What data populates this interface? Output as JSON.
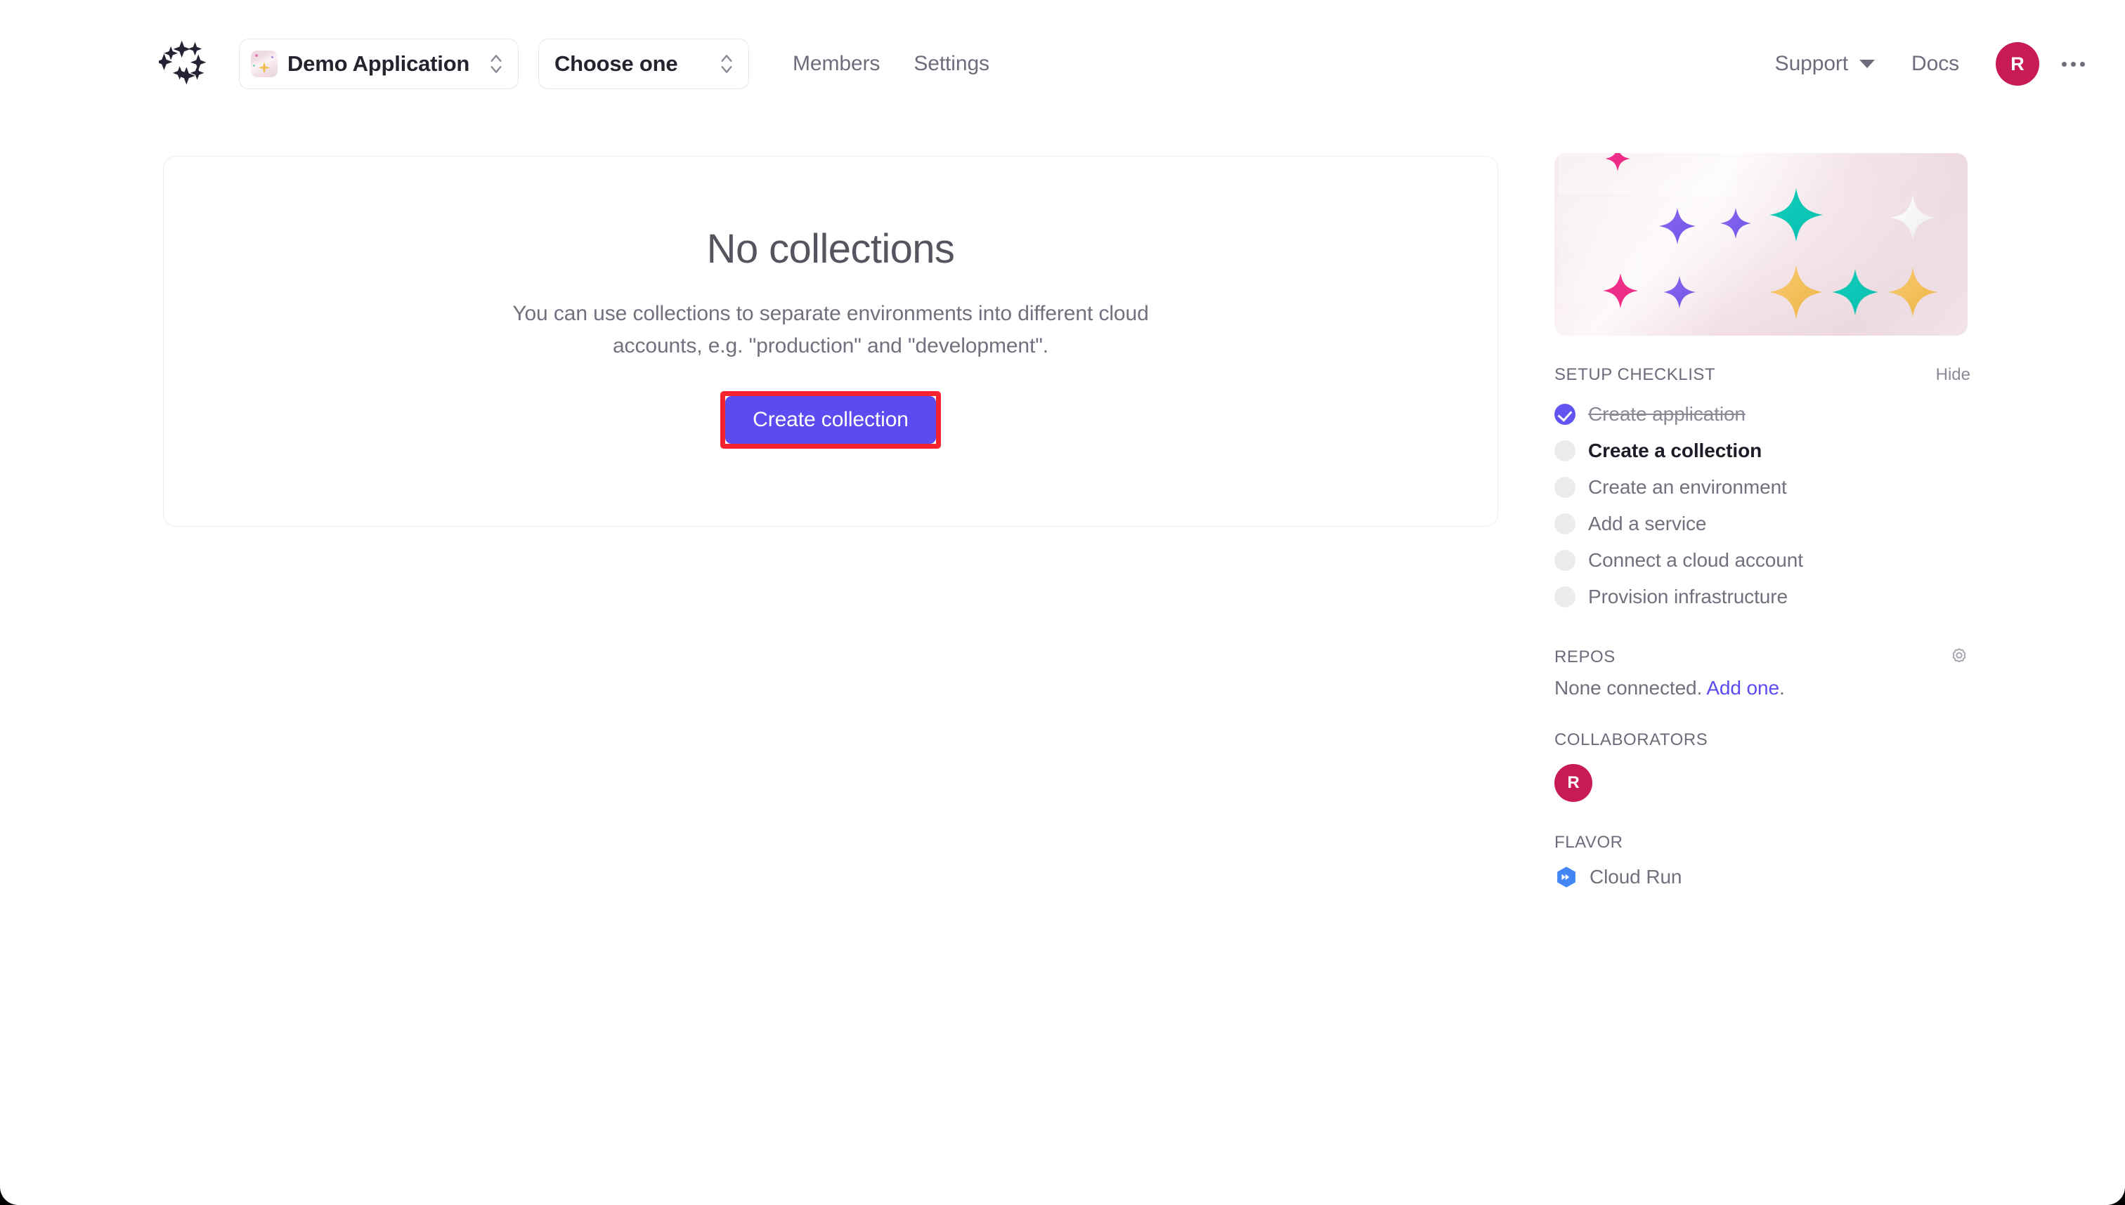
{
  "header": {
    "logo_icon": "sparkle-ring-logo",
    "app_switcher": {
      "name": "Demo Application",
      "icon": "app-thumbnail-icon",
      "stepper_icon": "chevron-up-down-icon"
    },
    "env_select": {
      "value": "Choose one",
      "stepper_icon": "chevron-up-down-icon"
    },
    "nav": [
      {
        "label": "Members"
      },
      {
        "label": "Settings"
      }
    ],
    "support": {
      "label": "Support",
      "caret_icon": "caret-down-icon"
    },
    "docs_label": "Docs",
    "avatar_initial": "R",
    "more_icon": "ellipsis-icon"
  },
  "main": {
    "empty_title": "No collections",
    "empty_desc": "You can use collections to separate environments into different cloud accounts, e.g. \"production\" and \"development\".",
    "cta_label": "Create collection",
    "highlight_color": "#f5232e",
    "cta_color": "#5b4bf0"
  },
  "sidebar": {
    "hero_icon": "sparkles-banner",
    "checklist": {
      "title": "SETUP CHECKLIST",
      "hide_label": "Hide",
      "items": [
        {
          "label": "Create application",
          "state": "done"
        },
        {
          "label": "Create a collection",
          "state": "active"
        },
        {
          "label": "Create an environment",
          "state": "todo"
        },
        {
          "label": "Add a service",
          "state": "todo"
        },
        {
          "label": "Connect a cloud account",
          "state": "todo"
        },
        {
          "label": "Provision infrastructure",
          "state": "todo"
        }
      ]
    },
    "repos": {
      "title": "REPOS",
      "settings_icon": "gear-icon",
      "empty_text": "None connected.",
      "link_text": "Add one",
      "link_suffix": "."
    },
    "collaborators": {
      "title": "COLLABORATORS",
      "avatars": [
        {
          "initial": "R",
          "color": "#c81a55"
        }
      ]
    },
    "flavor": {
      "title": "FLAVOR",
      "icon": "cloud-run-icon",
      "label": "Cloud Run"
    }
  }
}
